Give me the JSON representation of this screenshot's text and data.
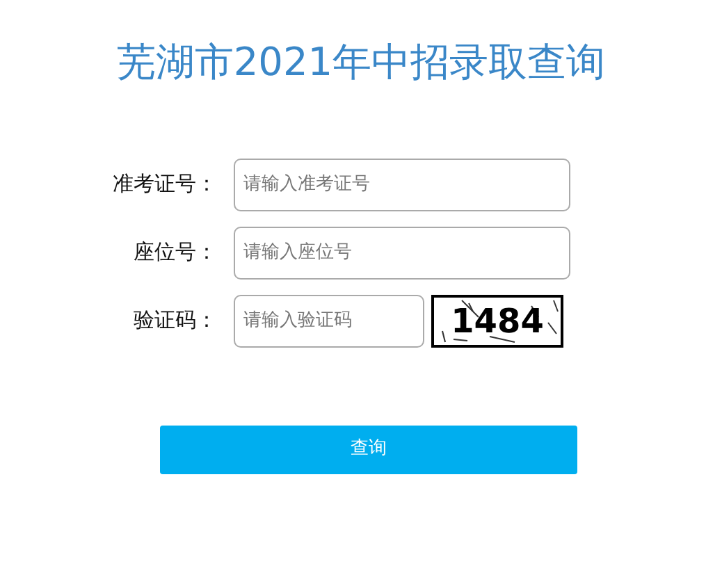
{
  "title": "芜湖市2021年中招录取查询",
  "fields": [
    {
      "kind": "text",
      "label": "准考证号：",
      "placeholder": "请输入准考证号"
    },
    {
      "kind": "text",
      "label": "座位号：",
      "placeholder": "请输入座位号"
    },
    {
      "kind": "captcha",
      "label": "验证码：",
      "placeholder": "请输入验证码",
      "captcha": "1484"
    }
  ],
  "submit": "查询"
}
